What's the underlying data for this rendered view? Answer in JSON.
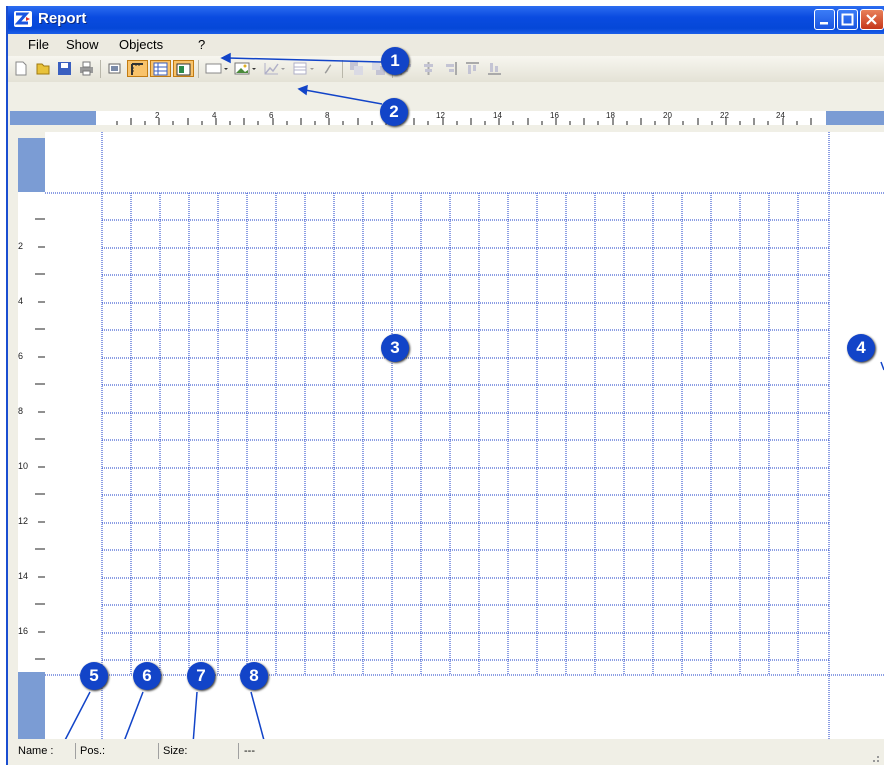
{
  "window": {
    "title": "Report"
  },
  "menu": {
    "items": [
      "File",
      "Show",
      "Objects",
      "?"
    ]
  },
  "toolbar": {
    "icons": [
      "new-icon",
      "open-icon",
      "save-icon",
      "print-icon",
      "properties-icon",
      "ruler-icon",
      "grid-icon",
      "preview-icon",
      "rectangle-icon",
      "picture-icon",
      "chart-icon",
      "table-icon",
      "formula-icon",
      "bring-front-icon",
      "send-back-icon",
      "align-left-icon",
      "align-center-icon",
      "align-right-icon",
      "align-top-icon",
      "align-bottom-icon"
    ]
  },
  "ruler_top": {
    "labels": [
      "2",
      "4",
      "6",
      "8",
      "12",
      "14",
      "16",
      "18",
      "20",
      "22",
      "24"
    ]
  },
  "ruler_left": {
    "labels": [
      "2",
      "4",
      "6",
      "8",
      "10",
      "12",
      "14",
      "16"
    ]
  },
  "status": {
    "name": "Name :",
    "pos": "Pos.:",
    "size": "Size:",
    "extra": "---"
  },
  "callouts": [
    "1",
    "2",
    "3",
    "4",
    "5",
    "6",
    "7",
    "8"
  ],
  "colors": {
    "title_bar": "#0a4be0",
    "ruler_blue": "#7b9cd4",
    "grid_line": "#1a3cc8",
    "callout": "#1244c8"
  }
}
